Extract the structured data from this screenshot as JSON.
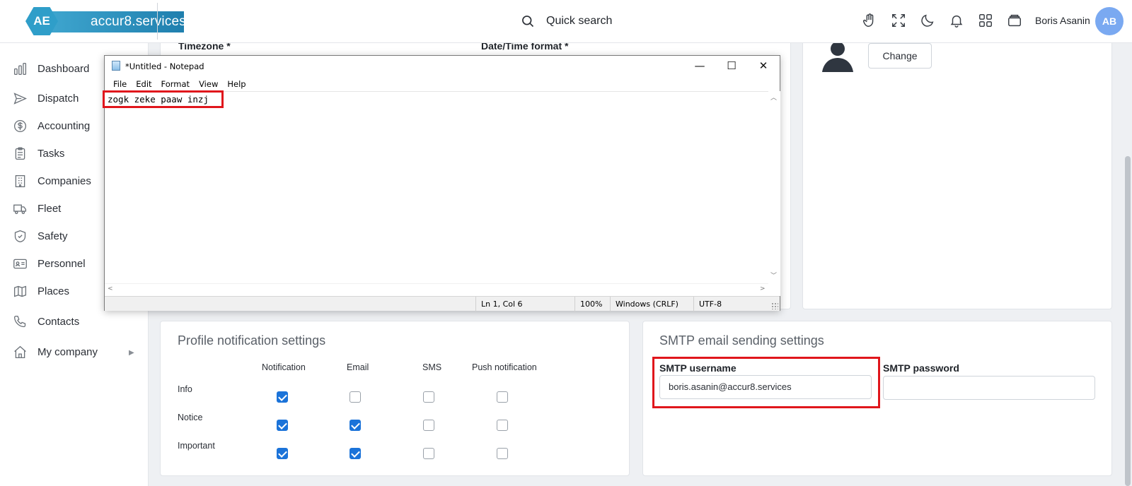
{
  "header": {
    "logo_mark": "AE",
    "logo_text": "accur8.services",
    "search_label": "Quick search",
    "user_name": "Boris Asanin",
    "user_initials": "AB",
    "icons": [
      "hand-icon",
      "fullscreen-icon",
      "moon-icon",
      "bell-icon",
      "apps-grid-icon",
      "wallet-icon"
    ]
  },
  "sidebar": {
    "items": [
      {
        "label": "Dashboard",
        "icon": "bar-chart-icon"
      },
      {
        "label": "Dispatch",
        "icon": "send-icon"
      },
      {
        "label": "Accounting",
        "icon": "dollar-icon"
      },
      {
        "label": "Tasks",
        "icon": "clipboard-icon"
      },
      {
        "label": "Companies",
        "icon": "building-icon"
      },
      {
        "label": "Fleet",
        "icon": "truck-icon"
      },
      {
        "label": "Safety",
        "icon": "shield-icon"
      },
      {
        "label": "Personnel",
        "icon": "id-card-icon"
      },
      {
        "label": "Places",
        "icon": "map-icon"
      },
      {
        "label": "Contacts",
        "icon": "phone-icon"
      },
      {
        "label": "My company",
        "icon": "home-icon"
      }
    ],
    "expand_arrow": "▶"
  },
  "settings_form": {
    "timezone_label": "Timezone *",
    "datetime_label": "Date/Time format *"
  },
  "profile_picture": {
    "change_label": "Change"
  },
  "notifications": {
    "title": "Profile notification settings",
    "columns": [
      "Notification",
      "Email",
      "SMS",
      "Push notification"
    ],
    "rows": [
      {
        "label": "Info",
        "checked": [
          true,
          false,
          false,
          false
        ]
      },
      {
        "label": "Notice",
        "checked": [
          true,
          true,
          false,
          false
        ]
      },
      {
        "label": "Important",
        "checked": [
          true,
          true,
          false,
          false
        ]
      }
    ]
  },
  "smtp": {
    "title": "SMTP email sending settings",
    "username_label": "SMTP username",
    "username_value": "boris.asanin@accur8.services",
    "password_label": "SMTP password",
    "password_value": ""
  },
  "notepad": {
    "title": "*Untitled - Notepad",
    "menu": [
      "File",
      "Edit",
      "Format",
      "View",
      "Help"
    ],
    "content": "zogk zeke paaw inzj",
    "status": {
      "position": "Ln 1, Col 6",
      "zoom": "100%",
      "line_ending": "Windows (CRLF)",
      "encoding": "UTF-8"
    },
    "controls": {
      "minimize": "—",
      "maximize": "☐",
      "close": "✕"
    }
  },
  "colors": {
    "accent": "#1b73d9",
    "highlight": "#e0161c",
    "brand": "#2f9ec9",
    "avatar": "#7aa9f1"
  }
}
